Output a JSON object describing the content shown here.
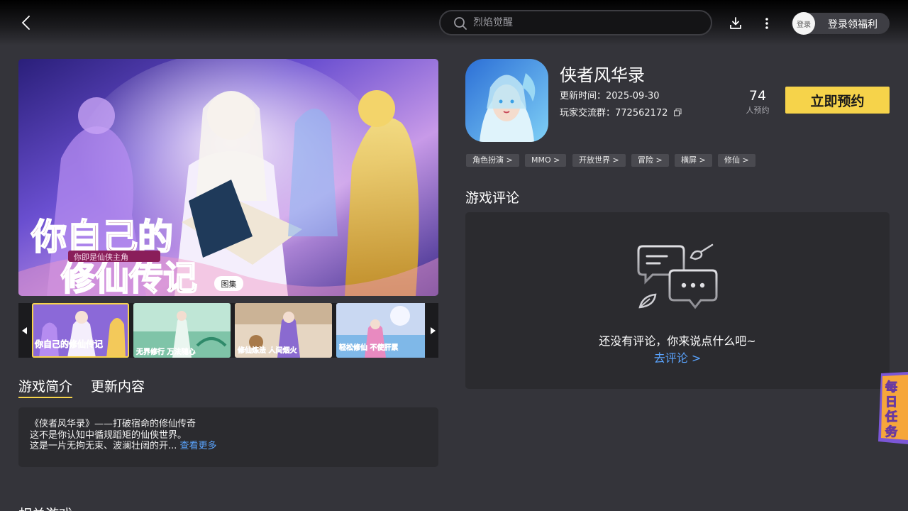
{
  "header": {
    "search_placeholder": "烈焰觉醒",
    "login_avatar_text": "登录",
    "login_label": "登录领福利"
  },
  "gallery": {
    "tag": "图集",
    "banner_text_main": "你自己的修仙传记",
    "banner_text_sub": "你即是仙侠主角",
    "thumbnails": [
      {
        "caption": "你自己的修仙传记"
      },
      {
        "caption": "无界修行 万法随心"
      },
      {
        "caption": "修仙炼法 人间烟火"
      },
      {
        "caption": "轻松修仙 不使肝累"
      }
    ]
  },
  "tabs": [
    {
      "label": "游戏简介",
      "active": true
    },
    {
      "label": "更新内容",
      "active": false
    }
  ],
  "intro": {
    "line1": "《侠者风华录》——打破宿命的修仙传奇",
    "line2": "这不是你认知中循规蹈矩的仙侠世界。",
    "line3": "这是一片无拘无束、波澜壮阔的开...",
    "more": "查看更多"
  },
  "related_title": "相关游戏",
  "game": {
    "title": "侠者风华录",
    "update_time": "更新时间：2025-09-30",
    "group": "玩家交流群：772562172",
    "reserve_count": "74",
    "reserve_label": "人预约",
    "reserve_button": "立即预约"
  },
  "tags": [
    "角色扮演 >",
    "MMO >",
    "开放世界 >",
    "冒险 >",
    "横屏 >",
    "修仙 >"
  ],
  "reviews": {
    "title": "游戏评论",
    "empty_text": "还没有评论，你来说点什么吧~",
    "empty_link": "去评论 >"
  },
  "daily_task": "每日任务",
  "colors": {
    "accent": "#f6d34a",
    "link": "#5aa4ff",
    "background": "#34343a",
    "card": "#2b2b2f"
  }
}
